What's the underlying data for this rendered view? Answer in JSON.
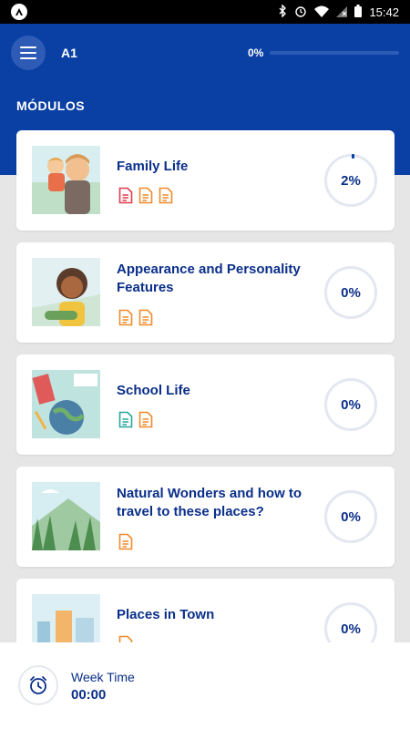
{
  "status_bar": {
    "time": "15:42",
    "icons": [
      "bluetooth-icon",
      "alarm-icon",
      "wifi-icon",
      "no-sim-icon",
      "battery-icon"
    ]
  },
  "header": {
    "level": "A1",
    "progress_text": "0%",
    "progress_fraction": 0.0,
    "section_title": "MÓDULOS",
    "colors": {
      "brand_blue": "#0a40a4",
      "title_blue": "#0a2f8a"
    }
  },
  "modules": [
    {
      "title": "Family Life",
      "progress": "2%",
      "docs": [
        "red",
        "orange",
        "orange"
      ],
      "thumb": "family"
    },
    {
      "title": "Appearance and Personality Features",
      "progress": "0%",
      "docs": [
        "orange",
        "orange"
      ],
      "thumb": "person"
    },
    {
      "title": "School Life",
      "progress": "0%",
      "docs": [
        "teal",
        "orange"
      ],
      "thumb": "school"
    },
    {
      "title": "Natural Wonders and how to travel to these places?",
      "progress": "0%",
      "docs": [
        "orange"
      ],
      "thumb": "nature"
    },
    {
      "title": "Places in Town",
      "progress": "0%",
      "docs": [
        "orange"
      ],
      "thumb": "town"
    }
  ],
  "doc_colors": {
    "red": "#e23b4d",
    "orange": "#f08a2a",
    "teal": "#25a79a"
  },
  "bottom_bar": {
    "label": "Week Time",
    "value": "00:00"
  }
}
